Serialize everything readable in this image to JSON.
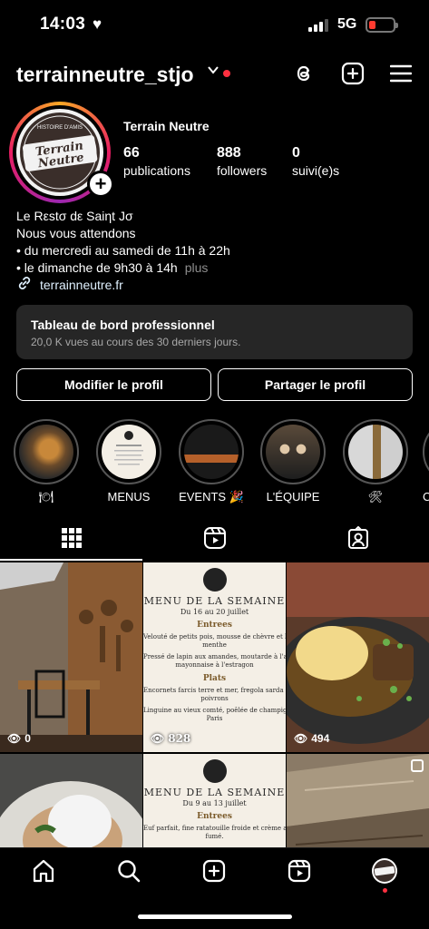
{
  "status_bar": {
    "time": "14:03",
    "network": "5G"
  },
  "header": {
    "username": "terrainneutre_stjo"
  },
  "profile": {
    "display_name": "Terrain Neutre",
    "stats": [
      {
        "value": "66",
        "label": "publications"
      },
      {
        "value": "888",
        "label": "followers"
      },
      {
        "value": "0",
        "label": "suivi(e)s"
      }
    ],
    "bio": [
      "Le Rεstσ dε Saiηt Jσ",
      "Nous vous attendons",
      "• du mercredi au samedi de 11h à 22h",
      "• le dimanche de 9h30 à 14h"
    ],
    "more_label": "plus",
    "link": "terrainneutre.fr",
    "avatar_logo_text": "Terrain Neutre",
    "avatar_arc_text": "HISTOIRE D'AMIS"
  },
  "dashboard": {
    "title": "Tableau de bord professionnel",
    "subtitle": "20,0 K vues au cours des 30 derniers jours."
  },
  "buttons": {
    "edit": "Modifier le profil",
    "share": "Partager le profil"
  },
  "highlights": [
    {
      "label": "🍽"
    },
    {
      "label": "MENUS"
    },
    {
      "label": "EVENTS 🎉"
    },
    {
      "label": "L'ÉQUIPE"
    },
    {
      "label": "🛠"
    },
    {
      "label": "C"
    }
  ],
  "posts": [
    {
      "views": "0"
    },
    {
      "views": "828",
      "menu_title": "MENU DE LA SEMAINE",
      "menu_dates": "Du 16 au 20 juillet",
      "sections": [
        {
          "name": "Entrees",
          "items": [
            "Velouté de petits pois, mousse de chèvre et huile",
            "menthe",
            "Pressé de lapin aux amandes, moutarde à l'ancien",
            "mayonnaise à l'estragon"
          ]
        },
        {
          "name": "Plats",
          "items": [
            "Encornets farcis terre et mer, fregola sarda et cou",
            "poivrons",
            "Linguine au vieux comté, poêlée de champignon",
            "Paris"
          ]
        }
      ]
    },
    {
      "views": "494"
    },
    {
      "views": ""
    },
    {
      "views": "",
      "menu_title": "MENU DE LA SEMAINE",
      "menu_dates": "Du 9 au 13 juillet",
      "sections": [
        {
          "name": "Entrees",
          "items": [
            "Euf parfait, fine ratatouille froide et crème au ro",
            "fumé."
          ]
        }
      ]
    },
    {
      "views": ""
    }
  ],
  "colors": {
    "accent_red": "#ff3040",
    "dash_bg": "#262626",
    "link": "#e0f1ff"
  }
}
